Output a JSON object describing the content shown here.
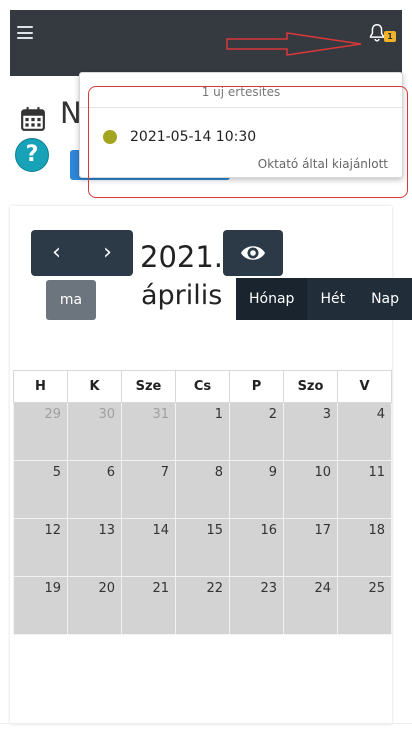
{
  "notifications": {
    "badge_count": "1",
    "header": "1 uj ertesites",
    "items": [
      {
        "date": "2021-05-14 10:30",
        "subtitle": "Oktató által kiajánlott",
        "dot_color": "#a3a420"
      }
    ]
  },
  "page": {
    "title_partial": "N",
    "help_label": "?"
  },
  "calendar": {
    "prev_label": "‹",
    "next_label": "›",
    "today_label": "ma",
    "title_year": "2021.",
    "title_month": "április",
    "views": [
      "Hónap",
      "Hét",
      "Nap"
    ],
    "active_view": "Hónap",
    "weekdays": [
      "H",
      "K",
      "Sze",
      "Cs",
      "P",
      "Szo",
      "V"
    ],
    "weeks": [
      [
        {
          "d": "29",
          "o": true
        },
        {
          "d": "30",
          "o": true
        },
        {
          "d": "31",
          "o": true
        },
        {
          "d": "1"
        },
        {
          "d": "2"
        },
        {
          "d": "3"
        },
        {
          "d": "4"
        }
      ],
      [
        {
          "d": "5"
        },
        {
          "d": "6"
        },
        {
          "d": "7"
        },
        {
          "d": "8"
        },
        {
          "d": "9"
        },
        {
          "d": "10"
        },
        {
          "d": "11"
        }
      ],
      [
        {
          "d": "12"
        },
        {
          "d": "13"
        },
        {
          "d": "14"
        },
        {
          "d": "15"
        },
        {
          "d": "16"
        },
        {
          "d": "17"
        },
        {
          "d": "18"
        }
      ],
      [
        {
          "d": "19"
        },
        {
          "d": "20"
        },
        {
          "d": "21"
        },
        {
          "d": "22"
        },
        {
          "d": "23"
        },
        {
          "d": "24"
        },
        {
          "d": "25"
        }
      ]
    ]
  },
  "colors": {
    "navbar": "#343a40",
    "badge": "#f0b429",
    "annotation_red": "#d9383a",
    "day_cell": "#d3d3d3"
  }
}
